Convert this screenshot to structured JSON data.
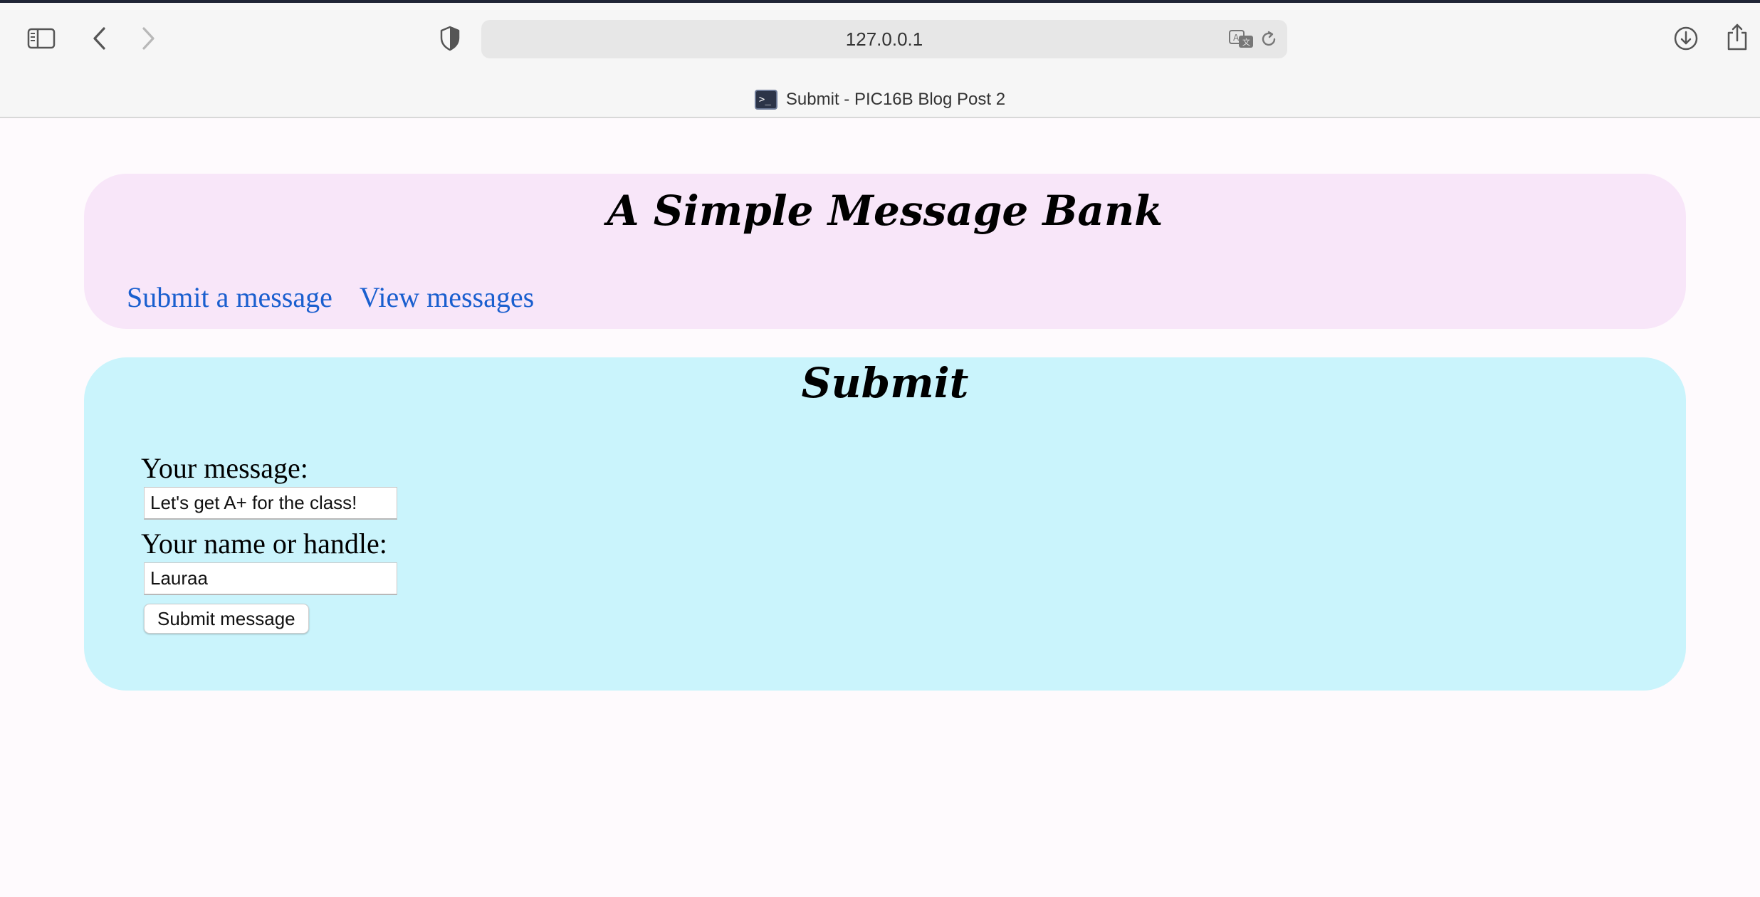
{
  "browser": {
    "address": "127.0.0.1",
    "tab_title": "Submit - PIC16B Blog Post 2",
    "icons": {
      "sidebar": "sidebar-icon",
      "back": "chevron-left-icon",
      "forward": "chevron-right-icon",
      "privacy": "shield-icon",
      "translate": "translate-icon",
      "reload": "reload-icon",
      "downloads": "download-icon",
      "share": "share-icon"
    }
  },
  "header": {
    "title": "A Simple Message Bank",
    "nav": {
      "submit_link": "Submit a message",
      "view_link": "View messages"
    }
  },
  "submit_section": {
    "title": "Submit",
    "message_label": "Your message:",
    "message_value": "Let's get A+ for the class!",
    "name_label": "Your name or handle:",
    "name_value": "Lauraa",
    "button_label": "Submit message"
  },
  "colors": {
    "header_bg": "#f8e6f9",
    "submit_bg": "#caf4fc",
    "link": "#1a5fcf",
    "page_bg": "#fefafd"
  }
}
